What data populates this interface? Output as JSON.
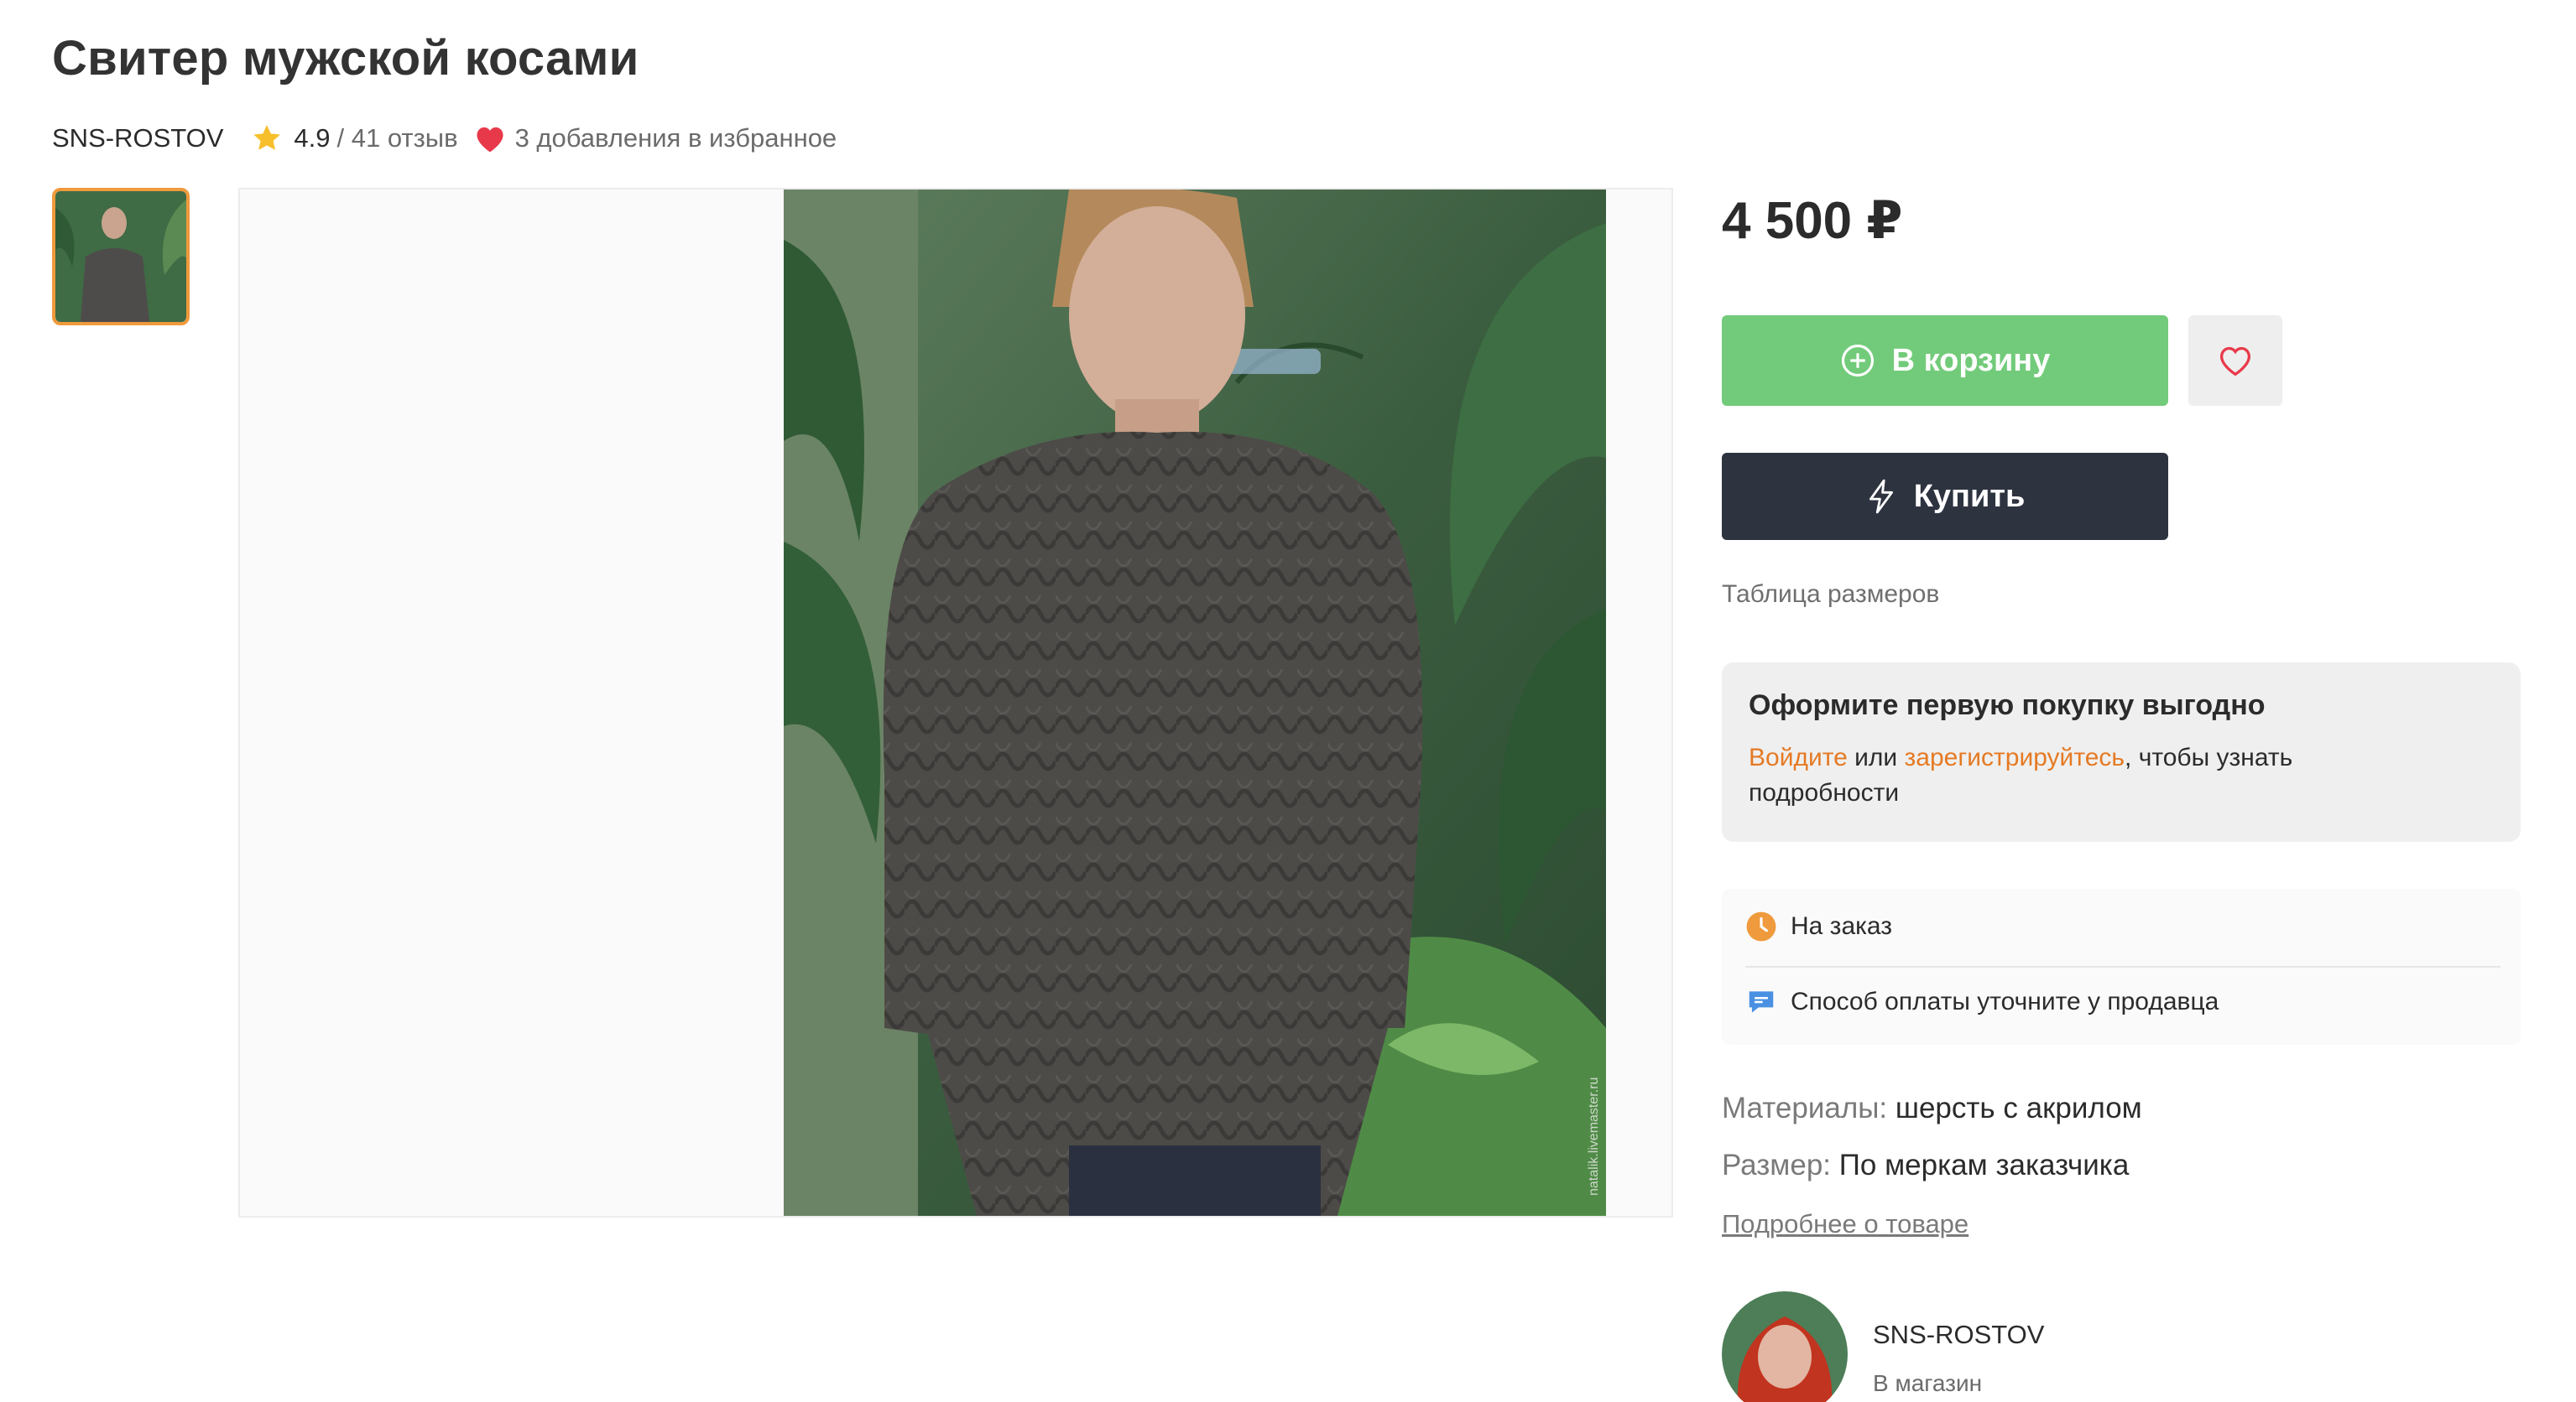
{
  "product": {
    "title": "Свитер мужской косами",
    "seller": "SNS-ROSTOV",
    "rating": "4.9",
    "reviews": "/ 41 отзыв",
    "favorites": "3 добавления в избранное",
    "price": "4 500 ₽",
    "watermark": "natalik.livemaster.ru"
  },
  "actions": {
    "cart_label": "В корзину",
    "buy_label": "Купить",
    "size_table": "Таблица размеров"
  },
  "promo": {
    "heading": "Оформите первую покупку выгодно",
    "login": "Войдите",
    "or": " или ",
    "register": "зарегистрируйтесь",
    "rest": ", чтобы узнать подробности"
  },
  "info": {
    "order": "На заказ",
    "payment": "Способ оплаты уточните у продавца"
  },
  "properties": {
    "materials_key": "Материалы:",
    "materials_value": "шерсть с акрилом",
    "size_key": "Размер:",
    "size_value": "По меркам заказчика",
    "details_link": "Подробнее о товаре"
  },
  "shop": {
    "name": "SNS-ROSTOV",
    "link": "В магазин"
  },
  "colors": {
    "accent_orange": "#e57a24",
    "cart_green": "#72cb7a",
    "buy_dark": "#2e3340",
    "heart_red": "#e8394a",
    "star_yellow": "#f7bf2b"
  },
  "icons": [
    "star-icon",
    "heart-icon",
    "plus-circle-icon",
    "heart-outline-icon",
    "lightning-icon",
    "clock-icon",
    "chat-icon"
  ]
}
